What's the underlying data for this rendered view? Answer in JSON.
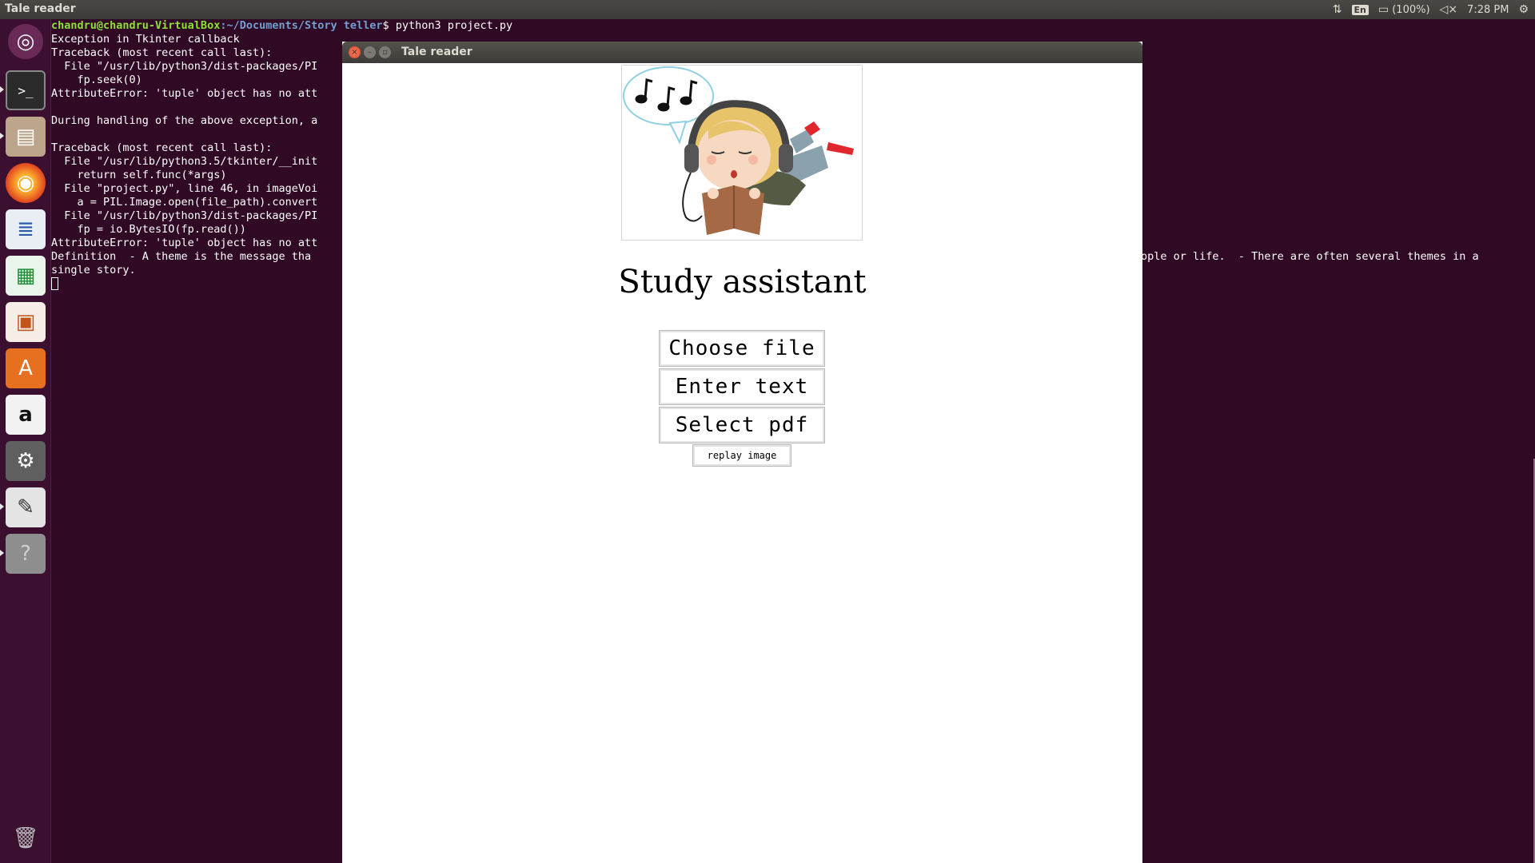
{
  "top_panel": {
    "app_title": "Tale reader",
    "lang": "En",
    "battery": "(100%)",
    "clock": "7:28 PM"
  },
  "launcher": {
    "terminal_glyph": ">_",
    "amazon_glyph": "a",
    "help_glyph": "?"
  },
  "terminal": {
    "prompt_user": "chandru@chandru-VirtualBox",
    "prompt_path": ":~/Documents/Story teller",
    "prompt_command": "$ python3 project.py",
    "lines": [
      "Exception in Tkinter callback",
      "Traceback (most recent call last):",
      "  File \"/usr/lib/python3/dist-packages/PI",
      "    fp.seek(0)",
      "AttributeError: 'tuple' object has no att",
      "",
      "During handling of the above exception, a",
      "",
      "Traceback (most recent call last):",
      "  File \"/usr/lib/python3.5/tkinter/__init",
      "    return self.func(*args)",
      "  File \"project.py\", line 46, in imageVoi",
      "    a = PIL.Image.open(file_path).convert",
      "  File \"/usr/lib/python3/dist-packages/PI",
      "    fp = io.BytesIO(fp.read())",
      "AttributeError: 'tuple' object has no att",
      "Definition  - A theme is the message tha",
      "single story."
    ],
    "definition_tail": "ople or life.  - There are often several themes in a"
  },
  "window": {
    "title": "Tale reader",
    "heading": "Study assistant",
    "buttons": {
      "choose_file": "Choose file",
      "enter_text": "Enter text",
      "select_pdf": "Select pdf",
      "replay_image": "replay image"
    }
  }
}
